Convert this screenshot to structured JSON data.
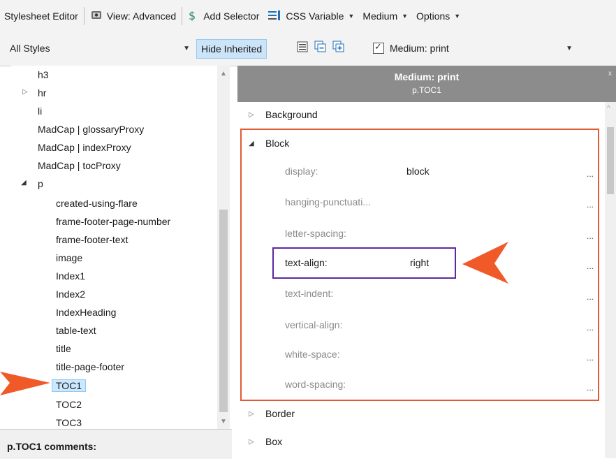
{
  "toolbar": {
    "title": "Stylesheet Editor",
    "view": "View: Advanced",
    "add_selector": "Add Selector",
    "css_variable": "CSS Variable",
    "medium": "Medium",
    "options": "Options"
  },
  "filter_bar": {
    "styles_combo": "All Styles",
    "hide_inherited": "Hide Inherited",
    "medium_checkbox": "Medium: print"
  },
  "tree": {
    "items": [
      {
        "label": "h3",
        "level": 1,
        "expander": ""
      },
      {
        "label": "hr",
        "level": 1,
        "expander": "collapsed"
      },
      {
        "label": "li",
        "level": 1,
        "expander": ""
      },
      {
        "label": "MadCap | glossaryProxy",
        "level": 1,
        "expander": ""
      },
      {
        "label": "MadCap | indexProxy",
        "level": 1,
        "expander": ""
      },
      {
        "label": "MadCap | tocProxy",
        "level": 1,
        "expander": ""
      },
      {
        "label": "p",
        "level": 1,
        "expander": "expanded"
      },
      {
        "label": "created-using-flare",
        "level": 2,
        "expander": ""
      },
      {
        "label": "frame-footer-page-number",
        "level": 2,
        "expander": ""
      },
      {
        "label": "frame-footer-text",
        "level": 2,
        "expander": ""
      },
      {
        "label": "image",
        "level": 2,
        "expander": ""
      },
      {
        "label": "Index1",
        "level": 2,
        "expander": ""
      },
      {
        "label": "Index2",
        "level": 2,
        "expander": ""
      },
      {
        "label": "IndexHeading",
        "level": 2,
        "expander": ""
      },
      {
        "label": "table-text",
        "level": 2,
        "expander": ""
      },
      {
        "label": "title",
        "level": 2,
        "expander": ""
      },
      {
        "label": "title-page-footer",
        "level": 2,
        "expander": ""
      },
      {
        "label": "TOC1",
        "level": 2,
        "expander": "",
        "selected": true
      },
      {
        "label": "TOC2",
        "level": 2,
        "expander": ""
      },
      {
        "label": "TOC3",
        "level": 2,
        "expander": ""
      }
    ]
  },
  "comments_label": "p.TOC1 comments:",
  "properties_panel": {
    "medium_title": "Medium: print",
    "selector_title": "p.TOC1",
    "sections": {
      "background": "Background",
      "block": "Block",
      "border": "Border",
      "box": "Box"
    },
    "block_properties": [
      {
        "name": "display:",
        "value": "block"
      },
      {
        "name": "hanging-punctuati...",
        "value": ""
      },
      {
        "name": "letter-spacing:",
        "value": ""
      },
      {
        "name": "text-align:",
        "value": "right"
      },
      {
        "name": "text-indent:",
        "value": ""
      },
      {
        "name": "vertical-align:",
        "value": ""
      },
      {
        "name": "white-space:",
        "value": ""
      },
      {
        "name": "word-spacing:",
        "value": ""
      }
    ],
    "ellipsis": "..."
  },
  "colors": {
    "callout_red": "#e25a33",
    "highlight_purple": "#5b2aa0",
    "arrow_orange": "#f05a28",
    "selection_blue": "#cce8ff"
  }
}
